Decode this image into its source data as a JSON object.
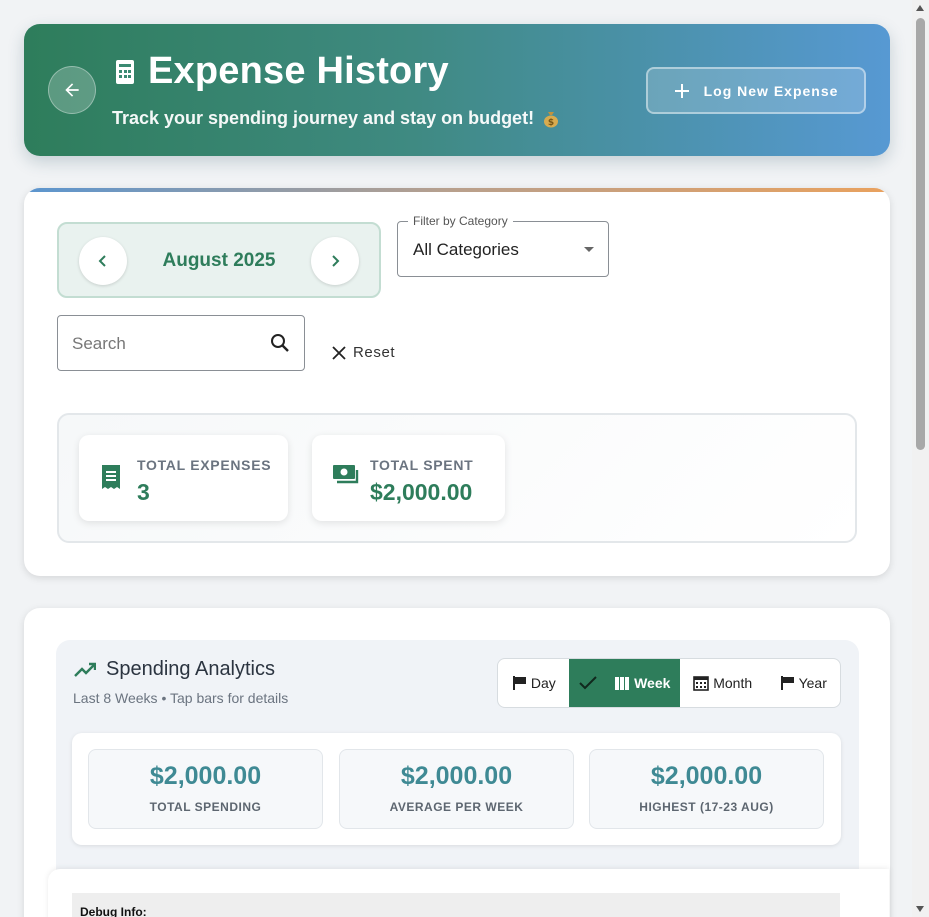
{
  "header": {
    "title": "Expense History",
    "subtitle": "Track your spending journey and stay on budget!",
    "log_button": "Log New Expense",
    "icons": {
      "back": "arrow-left-icon",
      "title": "receipt-icon",
      "subtitle": "money-bag-icon",
      "log": "plus-icon"
    }
  },
  "filters": {
    "month": "August 2025",
    "category_legend": "Filter by Category",
    "category_value": "All Categories",
    "search_placeholder": "Search",
    "search_value": "",
    "reset_label": "Reset"
  },
  "stats": [
    {
      "label": "TOTAL EXPENSES",
      "value": "3",
      "icon": "receipt-icon"
    },
    {
      "label": "TOTAL SPENT",
      "value": "$2,000.00",
      "icon": "cash-icon"
    }
  ],
  "analytics": {
    "title": "Spending Analytics",
    "subtitle": "Last 8 Weeks • Tap bars for details",
    "periods": [
      "Day",
      "Week",
      "Month",
      "Year"
    ],
    "selected_period": "Week",
    "summary": [
      {
        "value": "$2,000.00",
        "label": "TOTAL SPENDING"
      },
      {
        "value": "$2,000.00",
        "label": "AVERAGE PER WEEK"
      },
      {
        "value": "$2,000.00",
        "label": "HIGHEST (17-23 AUG)"
      }
    ]
  },
  "debug": {
    "title": "Debug Info:"
  },
  "colors": {
    "primary": "#2e7d5b",
    "header_gradient_start": "#2e7d5b",
    "header_gradient_end": "#5799d3",
    "summary_value": "#3f8a94"
  }
}
